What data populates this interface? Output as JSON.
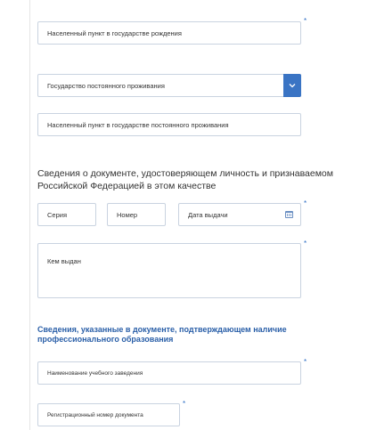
{
  "fields": {
    "birth_locality": {
      "placeholder": "Населенный пункт в государстве рождения"
    },
    "residence_country": {
      "value": "Государство постоянного проживания"
    },
    "residence_locality": {
      "placeholder": "Населенный пункт в государстве постоянного проживания"
    },
    "series": {
      "placeholder": "Серия"
    },
    "number": {
      "placeholder": "Номер"
    },
    "issue_date": {
      "placeholder": "Дата выдачи"
    },
    "issued_by": {
      "placeholder": "Кем выдан"
    },
    "institution_name": {
      "placeholder": "Наименование учебного заведения"
    },
    "doc_reg_number": {
      "placeholder": "Регистрационный номер документа"
    }
  },
  "sections": {
    "identity_doc": "Сведения о документе, удостоверяющем личность и признаваемом Российской Федерацией в этом качестве",
    "education_doc": "Сведения, указанные в документе, подтверждающем наличие профессионального образования"
  },
  "required_mark": "*",
  "colors": {
    "accent": "#3a74c4",
    "heading_blue": "#2a5fa8",
    "border": "#c9d3e0"
  },
  "icons": {
    "dropdown": "chevron-down-icon",
    "date": "calendar-icon"
  }
}
